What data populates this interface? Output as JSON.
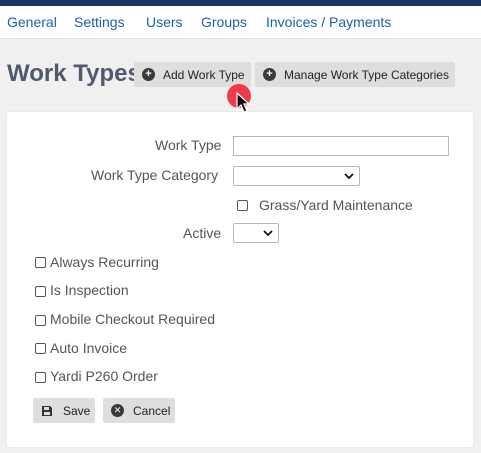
{
  "nav": {
    "items": [
      {
        "label": "General"
      },
      {
        "label": "Settings"
      },
      {
        "label": "Users"
      },
      {
        "label": "Groups"
      },
      {
        "label": "Invoices / Payments"
      }
    ]
  },
  "header": {
    "title": "Work Types",
    "add_label": "Add Work Type",
    "manage_label": "Manage Work Type Categories"
  },
  "form": {
    "work_type_label": "Work Type",
    "work_type_value": "",
    "category_label": "Work Type Category",
    "category_value": "",
    "grass_label": "Grass/Yard Maintenance",
    "active_label": "Active",
    "active_value": "",
    "checkboxes": [
      {
        "label": "Always Recurring",
        "checked": false
      },
      {
        "label": "Is Inspection",
        "checked": false
      },
      {
        "label": "Mobile Checkout Required",
        "checked": false
      },
      {
        "label": "Auto Invoice",
        "checked": false
      },
      {
        "label": "Yardi P260 Order",
        "checked": false
      }
    ],
    "save_label": "Save",
    "cancel_label": "Cancel"
  },
  "colors": {
    "topbar": "#1c3462",
    "nav_link": "#1f5fa8",
    "cursor_highlight": "#ee3b4a"
  }
}
